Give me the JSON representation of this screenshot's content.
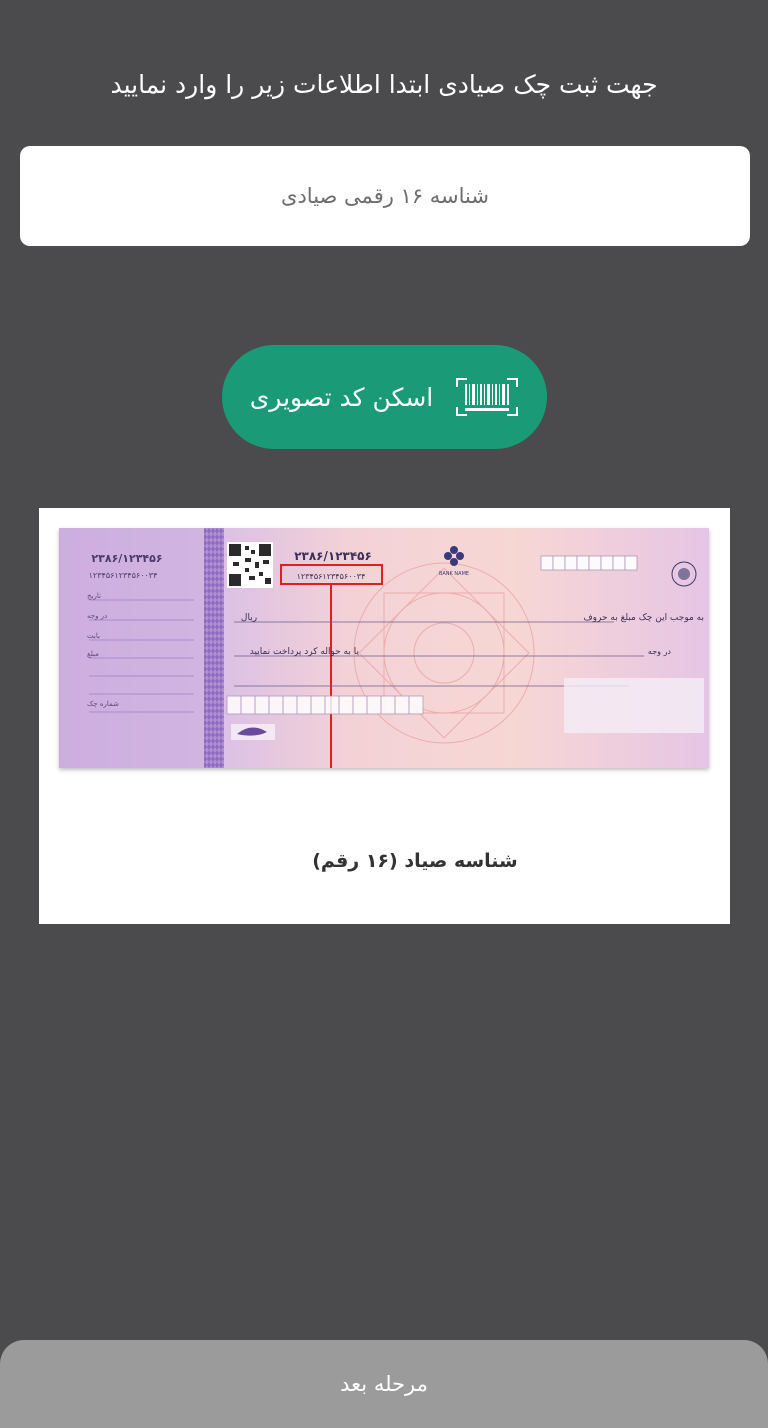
{
  "header": {
    "instruction": "جهت ثبت چک صیادی ابتدا اطلاعات زیر را وارد نمایید"
  },
  "form": {
    "sayad_id": {
      "value": "",
      "placeholder": "شناسه ۱۶ رقمی صیادی"
    }
  },
  "scan": {
    "label": "اسکن کد تصویری",
    "icon": "barcode-scan-icon",
    "color": "#1a9a77"
  },
  "sample_cheque": {
    "serial": "۲۳۸۶/۱۲۳۴۵۶",
    "sayad_number": "۱۲۳۴۵۶۱۲۳۴۵۶۰۰۳۴",
    "bank_name": "BANK NAME",
    "stub_labels": [
      "تاریخ",
      "در وجه",
      "بابت",
      "مبلغ",
      "شماره چک"
    ],
    "line_currency": "ریال",
    "line_pay_to": "به موجب این چک مبلغ به حروف",
    "line_order": "یا به حواله کرد پرداخت نمایید",
    "line_date": "در وجه",
    "caption": "شناسه صیاد (۱۶ رقم)",
    "highlight_color": "#e02020"
  },
  "footer": {
    "next_label": "مرحله بعد"
  }
}
